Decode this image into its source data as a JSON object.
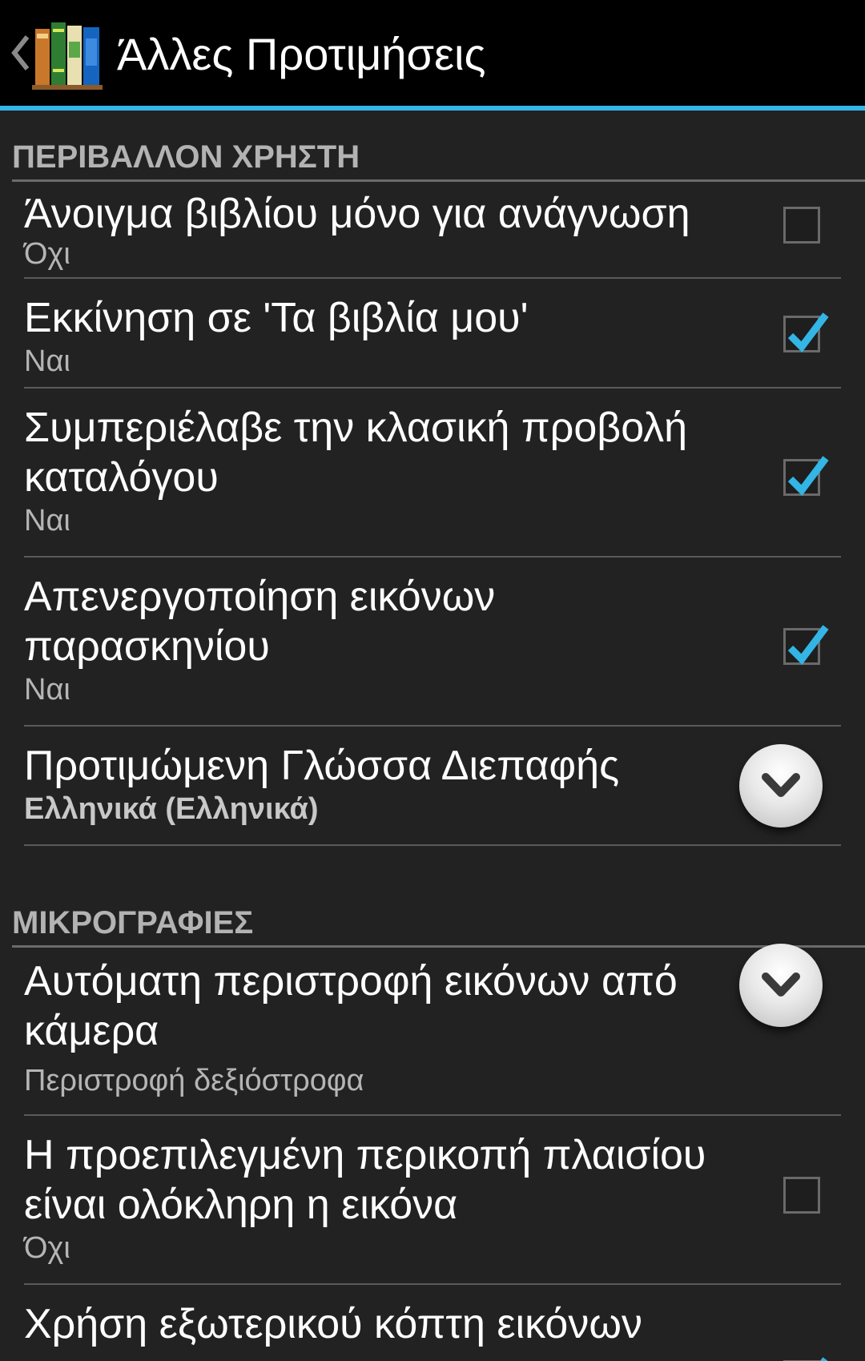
{
  "header": {
    "title": "Άλλες Προτιμήσεις",
    "up_icon": "chevron-left-icon",
    "app_icon": "books-icon"
  },
  "colors": {
    "accent": "#33b5e5",
    "background": "#222222",
    "section_text": "#b3b3b3"
  },
  "sections": [
    {
      "header": "ΠΕΡΙΒΑΛΛΟΝ ΧΡΗΣΤΗ",
      "items": [
        {
          "title": "Άνοιγμα βιβλίου μόνο για ανάγνωση",
          "summary": "Όχι",
          "control": "checkbox",
          "checked": false
        },
        {
          "title": "Εκκίνηση σε 'Τα βιβλία μου'",
          "summary": "Ναι",
          "control": "checkbox",
          "checked": true
        },
        {
          "title": "Συμπεριέλαβε την κλασική προβολή καταλόγου",
          "summary": "Ναι",
          "control": "checkbox",
          "checked": true
        },
        {
          "title": "Απενεργοποίηση εικόνων παρασκηνίου",
          "summary": "Ναι",
          "control": "checkbox",
          "checked": true
        },
        {
          "title": "Προτιμώμενη Γλώσσα Διεπαφής",
          "summary": "Ελληνικά (Ελληνικά)",
          "control": "dropdown"
        }
      ]
    },
    {
      "header": "ΜΙΚΡΟΓΡΑΦΙΕΣ",
      "items": [
        {
          "title": "Αυτόματη περιστροφή εικόνων από κάμερα",
          "summary": "Περιστροφή δεξιόστροφα",
          "control": "dropdown"
        },
        {
          "title": "Η προεπιλεγμένη περικοπή πλαισίου είναι ολόκληρη η εικόνα",
          "summary": "Όχι",
          "control": "checkbox",
          "checked": false
        },
        {
          "title": "Χρήση εξωτερικού κόπτη εικόνων",
          "summary": "",
          "control": "checkbox",
          "checked": true
        }
      ]
    }
  ]
}
